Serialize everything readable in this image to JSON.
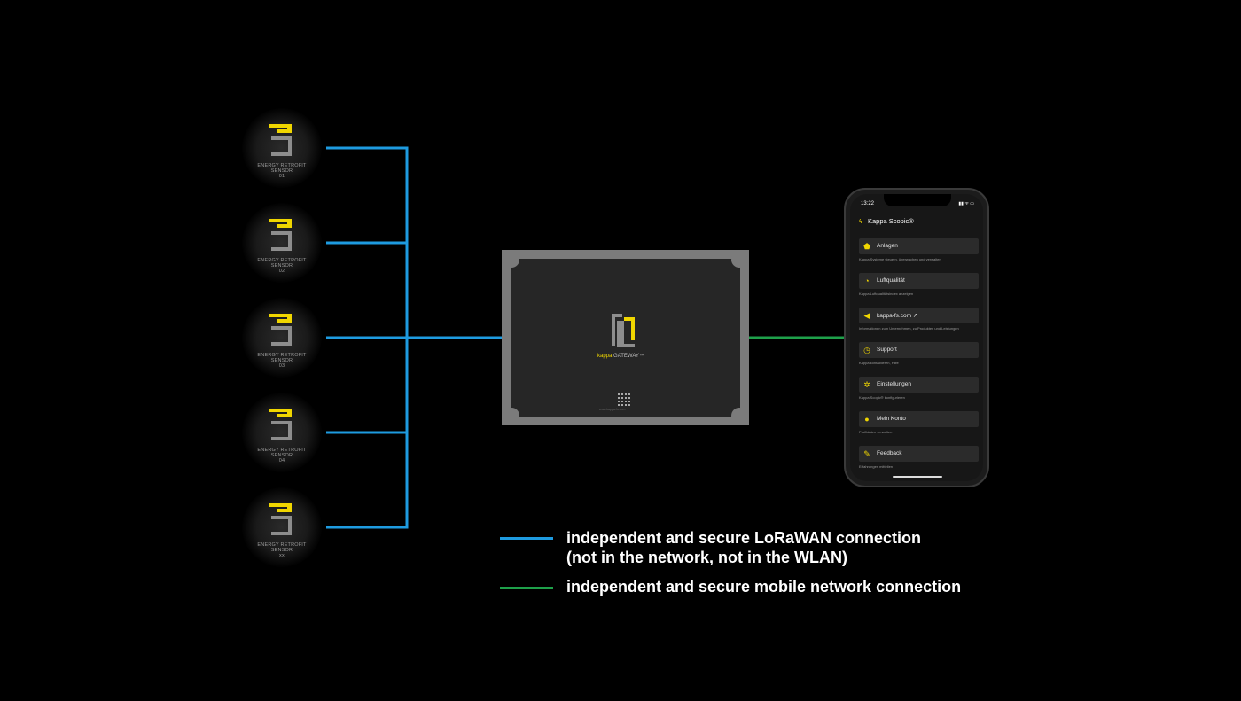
{
  "colors": {
    "background": "#000000",
    "lorawan": "#1e9be0",
    "mobile": "#1ea04a",
    "accent": "#f0d600",
    "gateway_frame": "#7b7b7b"
  },
  "sensors": [
    {
      "line1": "ENERGY RETROFIT",
      "line2": "SENSOR",
      "number": "01"
    },
    {
      "line1": "ENERGY RETROFIT",
      "line2": "SENSOR",
      "number": "02"
    },
    {
      "line1": "ENERGY RETROFIT",
      "line2": "SENSOR",
      "number": "03"
    },
    {
      "line1": "ENERGY RETROFIT",
      "line2": "SENSOR",
      "number": "04"
    },
    {
      "line1": "ENERGY RETROFIT",
      "line2": "SENSOR",
      "number": "xx"
    }
  ],
  "gateway": {
    "brand": "kappa",
    "label": "GATEWAY™",
    "url": "www.kappa-fs.com"
  },
  "phone": {
    "time": "13:22",
    "status_icons": "▮▮ ᯤ ▭",
    "app_title": "Kappa Scopic®",
    "items": [
      {
        "label": "Anlagen",
        "desc": "Kappa Systeme steuern, überwachen und verwalten",
        "icon": "shield-icon"
      },
      {
        "label": "Luftqualität",
        "desc": "Kappa Luftqualitätsindex anzeigen",
        "icon": "gauge-icon"
      },
      {
        "label": "kappa-fs.com ↗",
        "desc": "Informationen zum Unternehmen, zu Produkten und Leistungen",
        "icon": "kappa-logo-icon"
      },
      {
        "label": "Support",
        "desc": "Kappa kontaktieren, Hilfe",
        "icon": "support-icon"
      },
      {
        "label": "Einstellungen",
        "desc": "Kappa Scopic® konfigurieren",
        "icon": "settings-icon"
      },
      {
        "label": "Mein Konto",
        "desc": "Profildaten verwalten",
        "icon": "user-icon"
      },
      {
        "label": "Feedback",
        "desc": "Erfahrungen mitteilen",
        "icon": "pencil-icon"
      }
    ]
  },
  "legend": {
    "lorawan_line1": "independent and secure LoRaWAN connection",
    "lorawan_line2": "(not in the network, not in the WLAN)",
    "mobile": "independent and secure mobile network connection"
  }
}
